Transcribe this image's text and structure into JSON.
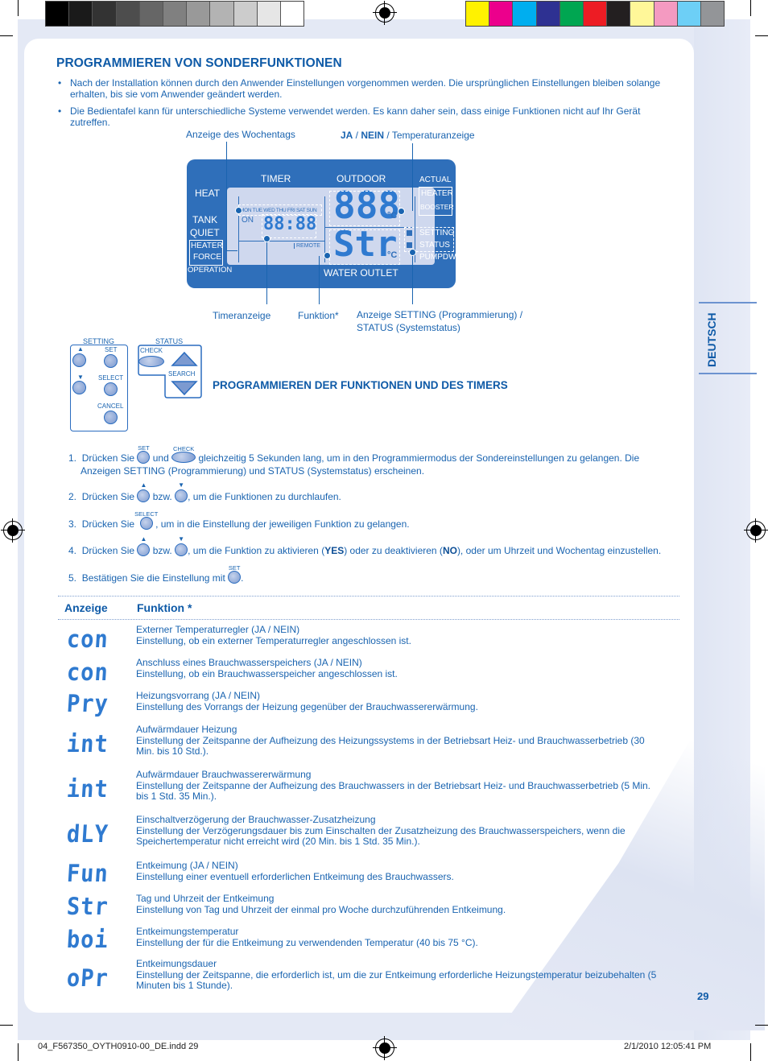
{
  "print_marks": {
    "gray_swatches": [
      "#000000",
      "#1a1a1a",
      "#333333",
      "#4d4d4d",
      "#666666",
      "#808080",
      "#999999",
      "#b3b3b3",
      "#cccccc",
      "#e6e6e6",
      "#ffffff"
    ],
    "color_swatches": [
      "#fff200",
      "#ec008c",
      "#00aeef",
      "#2e3192",
      "#00a651",
      "#ed1c24",
      "#231f20",
      "#fff799",
      "#f49ac1",
      "#6dcff6",
      "#939598"
    ]
  },
  "section_title": "PROGRAMMIEREN VON SONDERFUNKTIONEN",
  "bullets": [
    "Nach der Installation können durch den Anwender Einstellungen vorgenommen werden. Die ursprünglichen Einstellungen bleiben solange erhalten, bis sie vom Anwender geändert werden.",
    "Die Bedientafel kann für unterschiedliche Systeme verwendet werden. Es kann daher sein, dass einige Funktionen nicht auf Ihr Gerät zutreffen."
  ],
  "bullet_symbol": "•",
  "diagram": {
    "callouts": {
      "weekday": "Anzeige des Wochentags",
      "yes_no_prefix_ja": "JA",
      "yes_no_sep": " / ",
      "yes_no_prefix_nein": "NEIN",
      "yes_no_suffix": " / Temperaturanzeige",
      "timer": "Timeranzeige",
      "function": "Funktion*",
      "setting_status_line1": "Anzeige SETTING (Programmierung) /",
      "setting_status_line2": "STATUS (Systemstatus)"
    },
    "lcd": {
      "timer": "TIMER",
      "outdoor": "OUTDOOR",
      "actual": "ACTUAL",
      "heater": "HEATER",
      "booster": "BOOSTER",
      "heat": "HEAT",
      "tank": "TANK",
      "quiet": "QUIET",
      "heater_force_1": "HEATER",
      "heater_force_2": "FORCE",
      "operation": "OPERATION",
      "weekdays": "MON TUE WED THU FRI SAT SUN",
      "on": "ON",
      "clock": "88:88",
      "remote": "REMOTE",
      "temp_digits": "888",
      "function_digits": "Str",
      "celsius": "°C",
      "setting": "SETTING",
      "status": "STATUS",
      "pumpdw": "PUMPDW",
      "water_outlet": "WATER OUTLET"
    }
  },
  "control_panel": {
    "setting_label": "SETTING",
    "status_label": "STATUS",
    "set": "SET",
    "select": "SELECT",
    "cancel": "CANCEL",
    "check": "CHECK",
    "search": "SEARCH"
  },
  "subtitle": "PROGRAMMIEREN DER FUNKTIONEN UND DES TIMERS",
  "steps": {
    "s1_num": "1.",
    "s1_a": "Drücken Sie",
    "s1_b": "und",
    "s1_c": "gleichzeitig 5 Sekunden lang, um in den Programmiermodus der Sondereinstellungen zu gelangen. Die",
    "s1_d": "Anzeigen SETTING (Programmierung) und STATUS (Systemstatus) erscheinen.",
    "s2_num": "2.",
    "s2_a": "Drücken Sie",
    "s2_b": "bzw.",
    "s2_c": ", um die Funktionen zu durchlaufen.",
    "s3_num": "3.",
    "s3_a": "Drücken Sie",
    "s3_b": ", um in die Einstellung der jeweiligen Funktion zu gelangen.",
    "s4_num": "4.",
    "s4_a": "Drücken Sie",
    "s4_b": "bzw.",
    "s4_c": ", um die Funktion zu aktivieren (",
    "s4_yes": "YES",
    "s4_d": ") oder zu deaktivieren (",
    "s4_no": "NO",
    "s4_e": "), oder um Uhrzeit und Wochentag einzustellen.",
    "s5_num": "5.",
    "s5_a": "Bestätigen Sie die Einstellung mit",
    "s5_b": ".",
    "icon_set": "SET",
    "icon_check": "CHECK",
    "icon_select": "SELECT"
  },
  "table": {
    "col_display": "Anzeige",
    "col_function": "Funktion *",
    "rows": [
      {
        "code": "con",
        "name": "Externer Temperaturregler (JA / NEIN)",
        "desc": "Einstellung, ob ein externer Temperaturregler angeschlossen ist."
      },
      {
        "code": "con",
        "name": "Anschluss eines Brauchwasserspeichers (JA / NEIN)",
        "desc": "Einstellung, ob ein Brauchwasserspeicher angeschlossen ist."
      },
      {
        "code": "Pry",
        "name": "Heizungsvorrang (JA / NEIN)",
        "desc": "Einstellung des Vorrangs der Heizung gegenüber der Brauchwassererwärmung."
      },
      {
        "code": "int",
        "name": "Aufwärmdauer Heizung",
        "desc": "Einstellung der Zeitspanne der Aufheizung des Heizungssystems in der Betriebsart Heiz- und Brauchwasserbetrieb (30 Min. bis 10 Std.)."
      },
      {
        "code": "int",
        "name": "Aufwärmdauer Brauchwassererwärmung",
        "desc": "Einstellung der Zeitspanne der Aufheizung des Brauchwassers in der Betriebsart Heiz- und Brauchwasserbetrieb (5 Min. bis 1 Std. 35 Min.)."
      },
      {
        "code": "dLY",
        "name": "Einschaltverzögerung der Brauchwasser-Zusatzheizung",
        "desc": "Einstellung der Verzögerungsdauer bis zum Einschalten der Zusatzheizung des Brauchwasserspeichers, wenn die Speichertemperatur nicht erreicht wird (20 Min. bis 1 Std. 35 Min.)."
      },
      {
        "code": "Fun",
        "name": "Entkeimung (JA / NEIN)",
        "desc": "Einstellung einer eventuell erforderlichen Entkeimung des Brauchwassers."
      },
      {
        "code": "Str",
        "name": "Tag und Uhrzeit der Entkeimung",
        "desc": "Einstellung von Tag und Uhrzeit der einmal pro Woche durchzuführenden Entkeimung."
      },
      {
        "code": "boi",
        "name": "Entkeimungstemperatur",
        "desc": "Einstellung der für die Entkeimung zu verwendenden Temperatur (40 bis 75 °C)."
      },
      {
        "code": "oPr",
        "name": "Entkeimungsdauer",
        "desc": "Einstellung der Zeitspanne, die erforderlich ist, um die zur Entkeimung erforderliche Heizungstemperatur beizubehalten (5 Minuten bis 1 Stunde)."
      }
    ]
  },
  "language_tab": "DEUTSCH",
  "page_number": "29",
  "footer": {
    "file": "04_F567350_OYTH0910-00_DE.indd   29",
    "date": "2/1/2010   12:05:41 PM"
  }
}
